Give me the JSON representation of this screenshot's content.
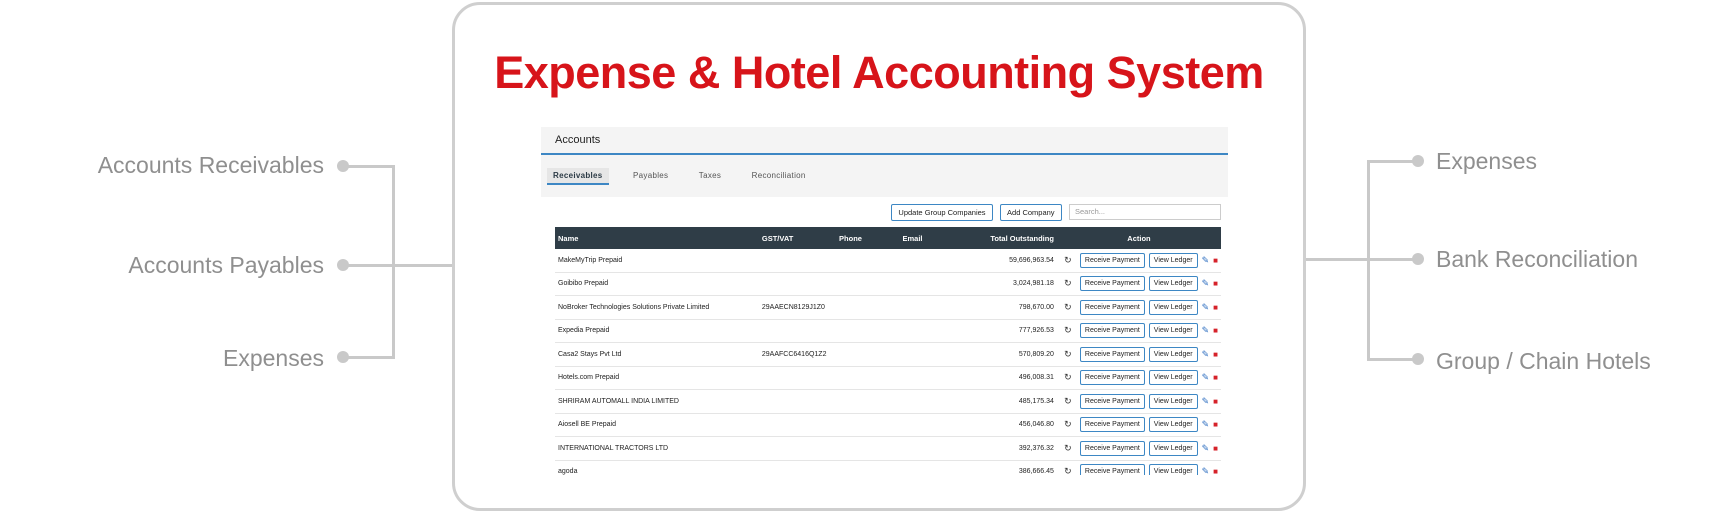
{
  "callouts": {
    "left": [
      "Accounts Receivables",
      "Accounts Payables",
      "Expenses"
    ],
    "right": [
      "Expenses",
      "Bank Reconciliation",
      "Group / Chain Hotels"
    ]
  },
  "headline": "Expense & Hotel Accounting System",
  "app": {
    "title": "Accounts",
    "tabs": [
      "Receivables",
      "Payables",
      "Taxes",
      "Reconciliation"
    ],
    "toolbar": {
      "update_label": "Update Group Companies",
      "add_label": "Add Company",
      "search_placeholder": "Search..."
    },
    "table": {
      "headers": [
        "Name",
        "GST/VAT",
        "Phone",
        "Email",
        "Total Outstanding",
        "Action"
      ],
      "action_labels": {
        "receive": "Receive Payment",
        "ledger": "View Ledger"
      },
      "rows": [
        {
          "name": "MakeMyTrip Prepaid",
          "gst": "",
          "phone": "",
          "email": "",
          "total": "59,696,963.54"
        },
        {
          "name": "Goibibo Prepaid",
          "gst": "",
          "phone": "",
          "email": "",
          "total": "3,024,981.18"
        },
        {
          "name": "NoBroker Technologies Solutions Private Limited",
          "gst": "29AAECN8129J1Z0",
          "phone": "",
          "email": "",
          "total": "798,670.00"
        },
        {
          "name": "Expedia Prepaid",
          "gst": "",
          "phone": "",
          "email": "",
          "total": "777,926.53"
        },
        {
          "name": "Casa2 Stays Pvt Ltd",
          "gst": "29AAFCC6416Q1Z2",
          "phone": "",
          "email": "",
          "total": "570,809.20"
        },
        {
          "name": "Hotels.com Prepaid",
          "gst": "",
          "phone": "",
          "email": "",
          "total": "496,008.31"
        },
        {
          "name": "SHRIRAM AUTOMALL INDIA LIMITED",
          "gst": "",
          "phone": "",
          "email": "",
          "total": "485,175.34"
        },
        {
          "name": "Aiosell BE Prepaid",
          "gst": "",
          "phone": "",
          "email": "",
          "total": "456,046.80"
        },
        {
          "name": "INTERNATIONAL TRACTORS LTD",
          "gst": "",
          "phone": "",
          "email": "",
          "total": "392,376.32"
        },
        {
          "name": "agoda",
          "gst": "",
          "phone": "",
          "email": "",
          "total": "386,666.45"
        }
      ]
    }
  },
  "colors": {
    "headline": "#d7141a",
    "table_header": "#2f3d47",
    "accent": "#3d87c4",
    "callout_text": "#8f8f8f",
    "connector": "#c9c9c9"
  },
  "icons": {
    "refresh": "refresh-icon",
    "edit": "pencil-icon",
    "delete": "trash-icon"
  }
}
